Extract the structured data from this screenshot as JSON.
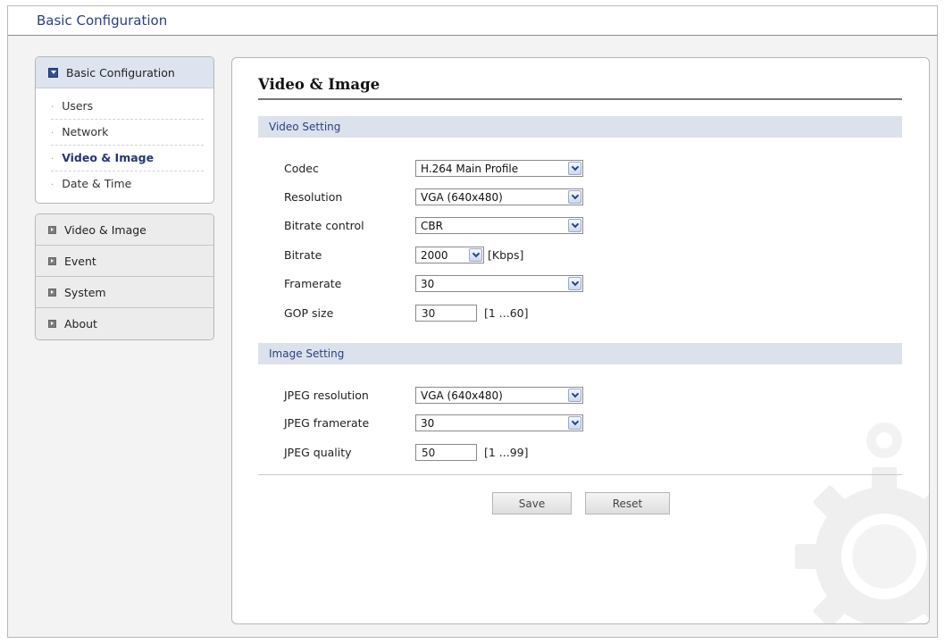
{
  "header": {
    "title": "Basic Configuration"
  },
  "sidebar": {
    "basic": {
      "label": "Basic Configuration",
      "items": [
        {
          "label": "Users"
        },
        {
          "label": "Network"
        },
        {
          "label": "Video & Image",
          "active": true
        },
        {
          "label": "Date & Time"
        }
      ]
    },
    "nav": [
      {
        "label": "Video & Image"
      },
      {
        "label": "Event"
      },
      {
        "label": "System"
      },
      {
        "label": "About"
      }
    ]
  },
  "main": {
    "title": "Video & Image",
    "video_section": {
      "title": "Video Setting",
      "codec": {
        "label": "Codec",
        "value": "H.264 Main Profile"
      },
      "resolution": {
        "label": "Resolution",
        "value": "VGA (640x480)"
      },
      "bitrate_control": {
        "label": "Bitrate control",
        "value": "CBR"
      },
      "bitrate": {
        "label": "Bitrate",
        "value": "2000",
        "unit": "[Kbps]"
      },
      "framerate": {
        "label": "Framerate",
        "value": "30"
      },
      "gop": {
        "label": "GOP size",
        "value": "30",
        "range": "[1 ...60]"
      }
    },
    "image_section": {
      "title": "Image Setting",
      "jpeg_resolution": {
        "label": "JPEG resolution",
        "value": "VGA (640x480)"
      },
      "jpeg_framerate": {
        "label": "JPEG framerate",
        "value": "30"
      },
      "jpeg_quality": {
        "label": "JPEG quality",
        "value": "50",
        "range": "[1 ...99]"
      }
    },
    "buttons": {
      "save": "Save",
      "reset": "Reset"
    }
  },
  "icons": {
    "checkbox": "checked-box-icon",
    "nav_arrow": "expand-arrow-icon",
    "dropdown": "chevron-down-icon",
    "watermark": "gear-icon"
  },
  "colors": {
    "accent": "#2b3f80",
    "section_bg": "#dce2ec",
    "sidebar_head_bg": "#dde3ef"
  }
}
